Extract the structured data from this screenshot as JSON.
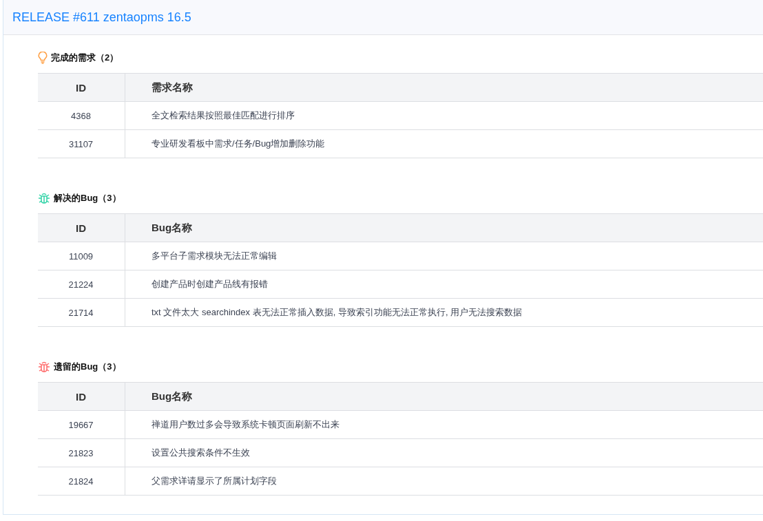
{
  "title": "RELEASE #611 zentaopms 16.5",
  "sections": [
    {
      "kind": "story",
      "color": "#ff9f43",
      "heading": "完成的需求（2）",
      "columns": [
        "ID",
        "需求名称"
      ],
      "rows": [
        {
          "id": "4368",
          "name": "全文检索结果按照最佳匹配进行排序"
        },
        {
          "id": "31107",
          "name": "专业研发看板中需求/任务/Bug增加删除功能"
        }
      ]
    },
    {
      "kind": "bug",
      "color": "#2fd3a6",
      "heading": "解决的Bug（3）",
      "columns": [
        "ID",
        "Bug名称"
      ],
      "rows": [
        {
          "id": "11009",
          "name": "多平台子需求模块无法正常编辑"
        },
        {
          "id": "21224",
          "name": "创建产品时创建产品线有报错"
        },
        {
          "id": "21714",
          "name": "txt 文件太大 searchindex 表无法正常插入数据, 导致索引功能无法正常执行, 用户无法搜索数据"
        }
      ]
    },
    {
      "kind": "bug",
      "color": "#ff6b6b",
      "heading": "遗留的Bug（3）",
      "columns": [
        "ID",
        "Bug名称"
      ],
      "rows": [
        {
          "id": "19667",
          "name": "禅道用户数过多会导致系统卡顿页面刷新不出来"
        },
        {
          "id": "21823",
          "name": "设置公共搜索条件不生效"
        },
        {
          "id": "21824",
          "name": "父需求详请显示了所属计划字段"
        }
      ]
    }
  ]
}
